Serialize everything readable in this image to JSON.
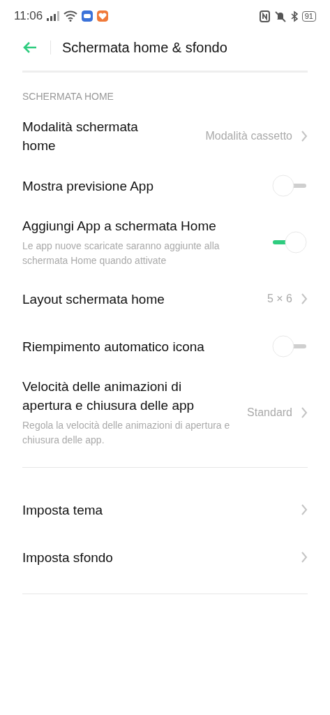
{
  "status_bar": {
    "time": "11:06",
    "battery": "91"
  },
  "header": {
    "title": "Schermata home & sfondo"
  },
  "sections": [
    {
      "title": "SCHERMATA HOME",
      "items": [
        {
          "kind": "link",
          "label": "Modalità schermata home",
          "value": "Modalità cassetto"
        },
        {
          "kind": "switch",
          "label": "Mostra previsione App",
          "on": false
        },
        {
          "kind": "switch",
          "label": "Aggiungi App a schermata Home",
          "description": "Le app nuove scaricate saranno aggiunte alla schermata Home quando attivate",
          "on": true
        },
        {
          "kind": "link",
          "label": "Layout schermata home",
          "value": "5 × 6"
        },
        {
          "kind": "switch",
          "label": "Riempimento automatico icona",
          "on": false
        },
        {
          "kind": "link",
          "label": "Velocità delle animazioni di apertura e chiusura delle app",
          "description": "Regola la velocità delle animazioni di apertura e chiusura delle app.",
          "value": "Standard"
        }
      ]
    },
    {
      "items": [
        {
          "kind": "link",
          "label": "Imposta tema"
        },
        {
          "kind": "link",
          "label": "Imposta sfondo"
        }
      ]
    }
  ]
}
